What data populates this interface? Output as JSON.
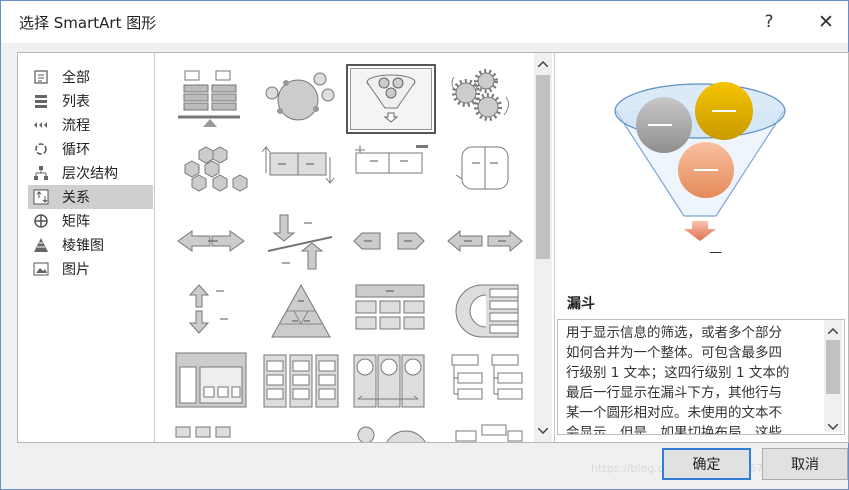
{
  "window": {
    "title": "选择 SmartArt 图形",
    "help_label": "?",
    "close_label": "✕"
  },
  "categories": [
    {
      "label": "全部",
      "icon": "all-icon",
      "selected": false
    },
    {
      "label": "列表",
      "icon": "list-icon",
      "selected": false
    },
    {
      "label": "流程",
      "icon": "process-icon",
      "selected": false
    },
    {
      "label": "循环",
      "icon": "cycle-icon",
      "selected": false
    },
    {
      "label": "层次结构",
      "icon": "hierarchy-icon",
      "selected": false
    },
    {
      "label": "关系",
      "icon": "relationship-icon",
      "selected": true
    },
    {
      "label": "矩阵",
      "icon": "matrix-icon",
      "selected": false
    },
    {
      "label": "棱锥图",
      "icon": "pyramid-icon",
      "selected": false
    },
    {
      "label": "图片",
      "icon": "picture-icon",
      "selected": false
    }
  ],
  "gallery": {
    "selected_item": "funnel",
    "items": [
      "balance",
      "circle-relationship",
      "funnel",
      "gears",
      "hexagon-cluster",
      "arrow-ribbon",
      "counterbalance-arrows",
      "opposing-ideas",
      "converging-arrows",
      "diverging-arrows",
      "plus-minus-arrows",
      "opposing-arrows",
      "arrow-up-down",
      "segmented-pyramid",
      "table-list",
      "nested-target",
      "tabbed-list",
      "vertical-list",
      "circle-columns",
      "hierarchy-list"
    ]
  },
  "preview": {
    "dash_label": "—",
    "caption": "—",
    "colors": {
      "gray": "#a6a6a6",
      "gold": "#e8b200",
      "orange": "#f0a070",
      "funnel": "#9dc3e6"
    }
  },
  "description": {
    "title": "漏斗",
    "lines": [
      "用于显示信息的筛选，或者多个部分",
      "如何合并为一个整体。可包含最多四",
      "行级别 1 文本；这四行级别 1 文本的",
      "最后一行显示在漏斗下方，其他行与",
      "某一个圆形相对应。未使用的文本不",
      "会显示，但是，如果切换布局，这些"
    ]
  },
  "buttons": {
    "ok_label": "确定",
    "cancel_label": "取消"
  },
  "watermark": "https://blog.csdn.net/qq_35367305"
}
